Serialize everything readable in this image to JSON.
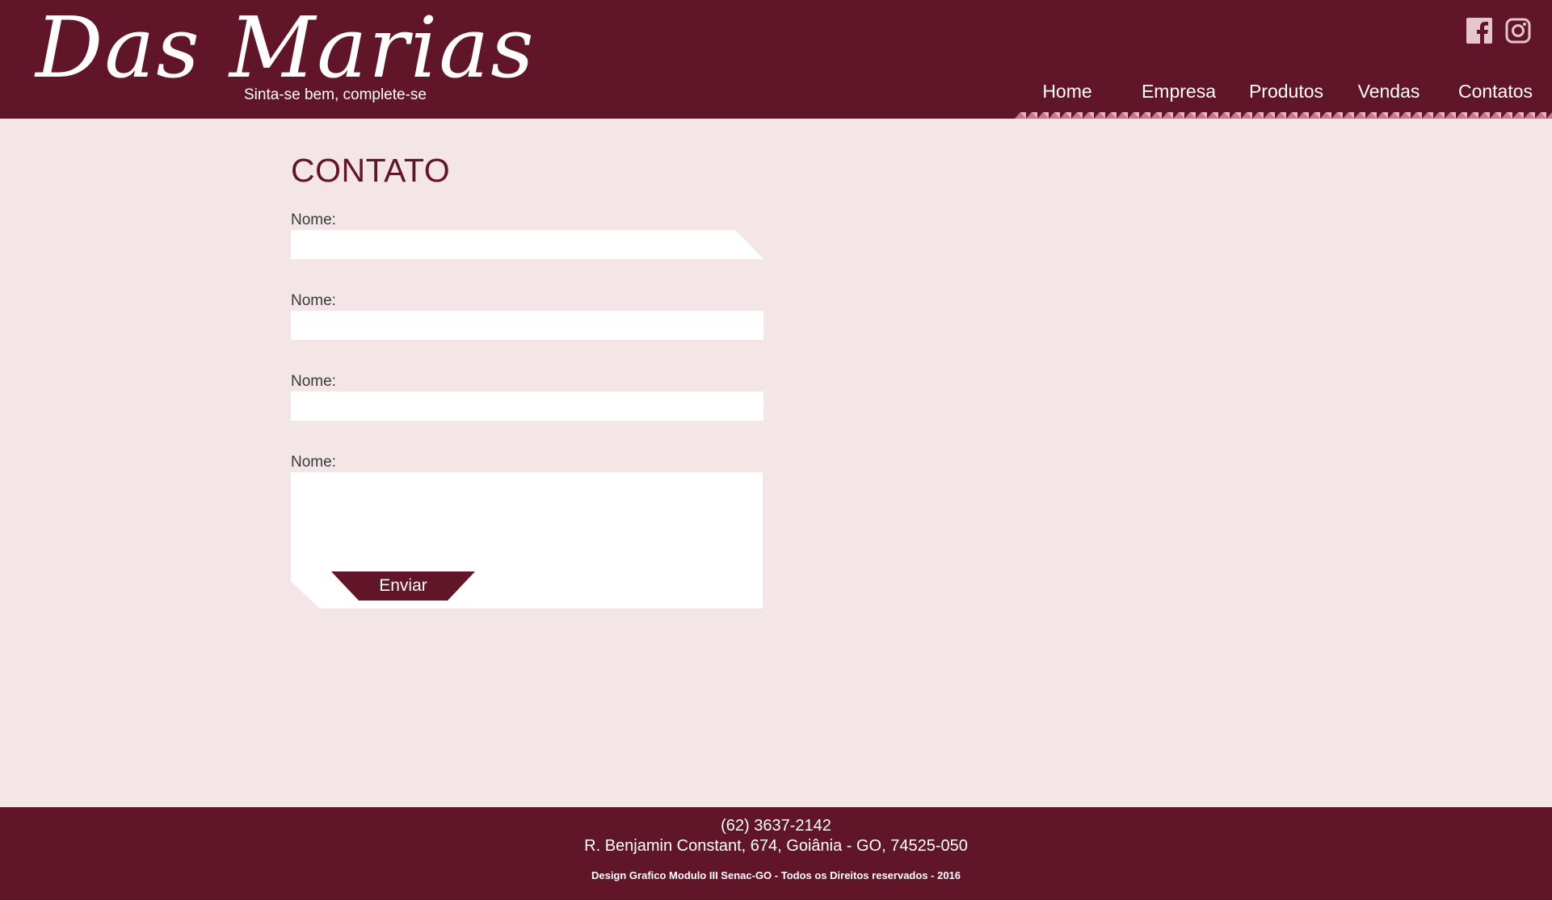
{
  "header": {
    "logo_title": "Das Marias",
    "logo_tagline": "Sinta-se bem, complete-se",
    "social": [
      "facebook-icon",
      "instagram-icon"
    ],
    "nav": [
      "Home",
      "Empresa",
      "Produtos",
      "Vendas",
      "Contatos"
    ]
  },
  "main": {
    "title": "CONTATO",
    "fields": [
      {
        "label": "Nome:",
        "value": ""
      },
      {
        "label": "Nome:",
        "value": ""
      },
      {
        "label": "Nome:",
        "value": ""
      },
      {
        "label": "Nome:",
        "value": ""
      }
    ],
    "submit_label": "Enviar"
  },
  "footer": {
    "phone": "(62) 3637-2142",
    "address": "R. Benjamin Constant, 674, Goiânia - GO, 74525-050",
    "copyright": "Design Grafico Modulo III Senac-GO - Todos os Direitos reservados - 2016"
  },
  "colors": {
    "primary": "#611528",
    "background": "#f4e6e7",
    "accent_pattern": "#c67a89"
  }
}
